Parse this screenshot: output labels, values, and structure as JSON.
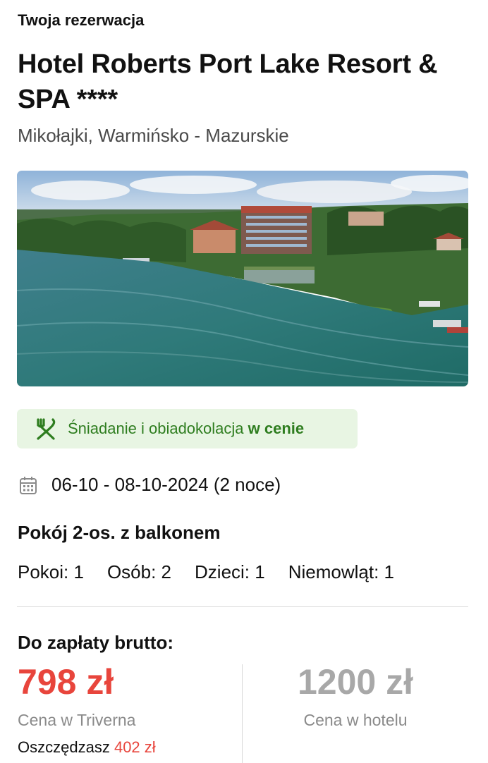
{
  "booking": {
    "section_title": "Twoja rezerwacja",
    "hotel_name": "Hotel Roberts Port Lake Resort & SPA ****",
    "location": "Mikołajki, Warmińsko - Mazurskie",
    "meal": {
      "icon": "fork-knife-icon",
      "text": "Śniadanie i obiadokolacja",
      "included": "w cenie",
      "color": "#2e7d1f",
      "background": "#e8f5e3"
    },
    "dates": {
      "icon": "calendar-icon",
      "text": "06-10 - 08-10-2024 (2 noce)"
    },
    "room_name": "Pokój 2-os. z balkonem",
    "occupancy": {
      "rooms": "Pokoi: 1",
      "persons": "Osób: 2",
      "children": "Dzieci: 1",
      "infants": "Niemowląt: 1"
    }
  },
  "payment": {
    "label": "Do zapłaty brutto:",
    "price": "798 zł",
    "price_label": "Cena w Triverna",
    "savings_prefix": "Oszczędzasz",
    "savings_amount": "402 zł",
    "hotel_price": "1200 zł",
    "hotel_price_label": "Cena w hotelu",
    "accent_color": "#e8453c"
  }
}
